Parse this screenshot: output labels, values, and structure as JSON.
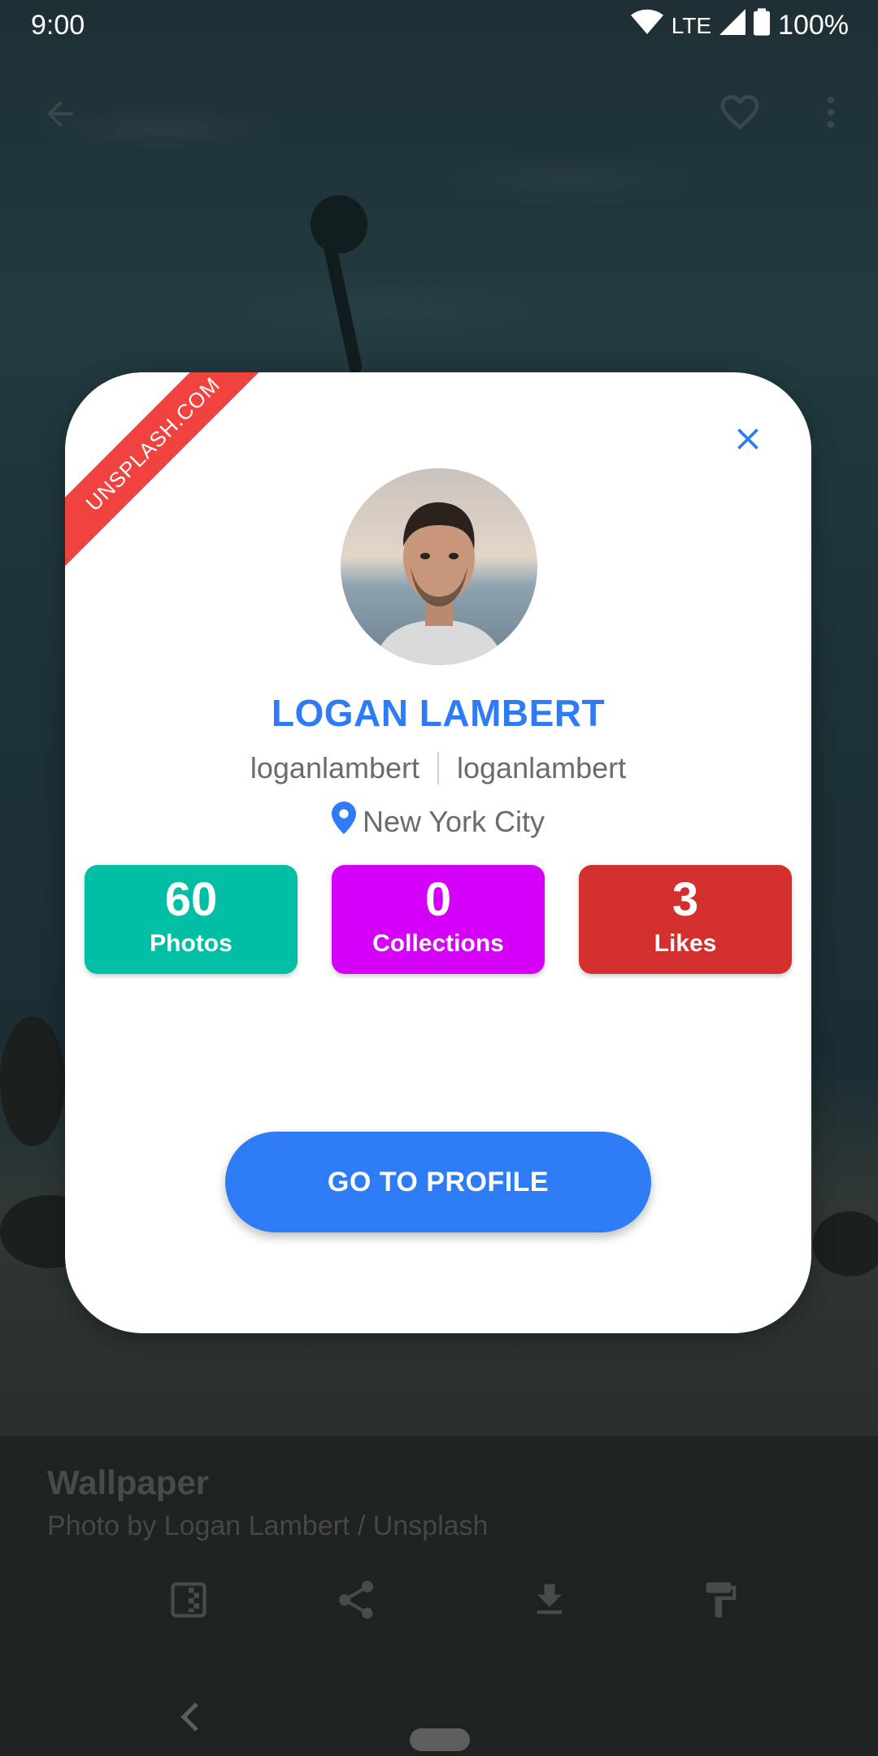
{
  "status_bar": {
    "time": "9:00",
    "network": "LTE",
    "battery": "100%"
  },
  "toolbar": {
    "back_icon": "arrow-back-icon",
    "favorite_icon": "heart-outline-icon",
    "menu_icon": "more-vert-icon"
  },
  "dialog": {
    "ribbon_text": "UNSPLASH.COM",
    "close_icon": "close-icon",
    "name": "LOGAN LAMBERT",
    "username_1": "loganlambert",
    "username_2": "loganlambert",
    "location": "New York City",
    "stats": [
      {
        "value": "60",
        "label": "Photos",
        "color": "#00bfa5"
      },
      {
        "value": "0",
        "label": "Collections",
        "color": "#d500f9"
      },
      {
        "value": "3",
        "label": "Likes",
        "color": "#d32f2f"
      }
    ],
    "profile_button": "GO TO PROFILE",
    "accent_color": "#2f7bf5"
  },
  "info_panel": {
    "title": "Wallpaper",
    "credit": "Photo by Logan Lambert / Unsplash",
    "actions": [
      "set-wallpaper-icon",
      "share-icon",
      "download-icon",
      "paint-roller-icon"
    ]
  },
  "nav_bar": {
    "back_icon": "nav-back-icon",
    "home_icon": "home-pill-icon"
  }
}
